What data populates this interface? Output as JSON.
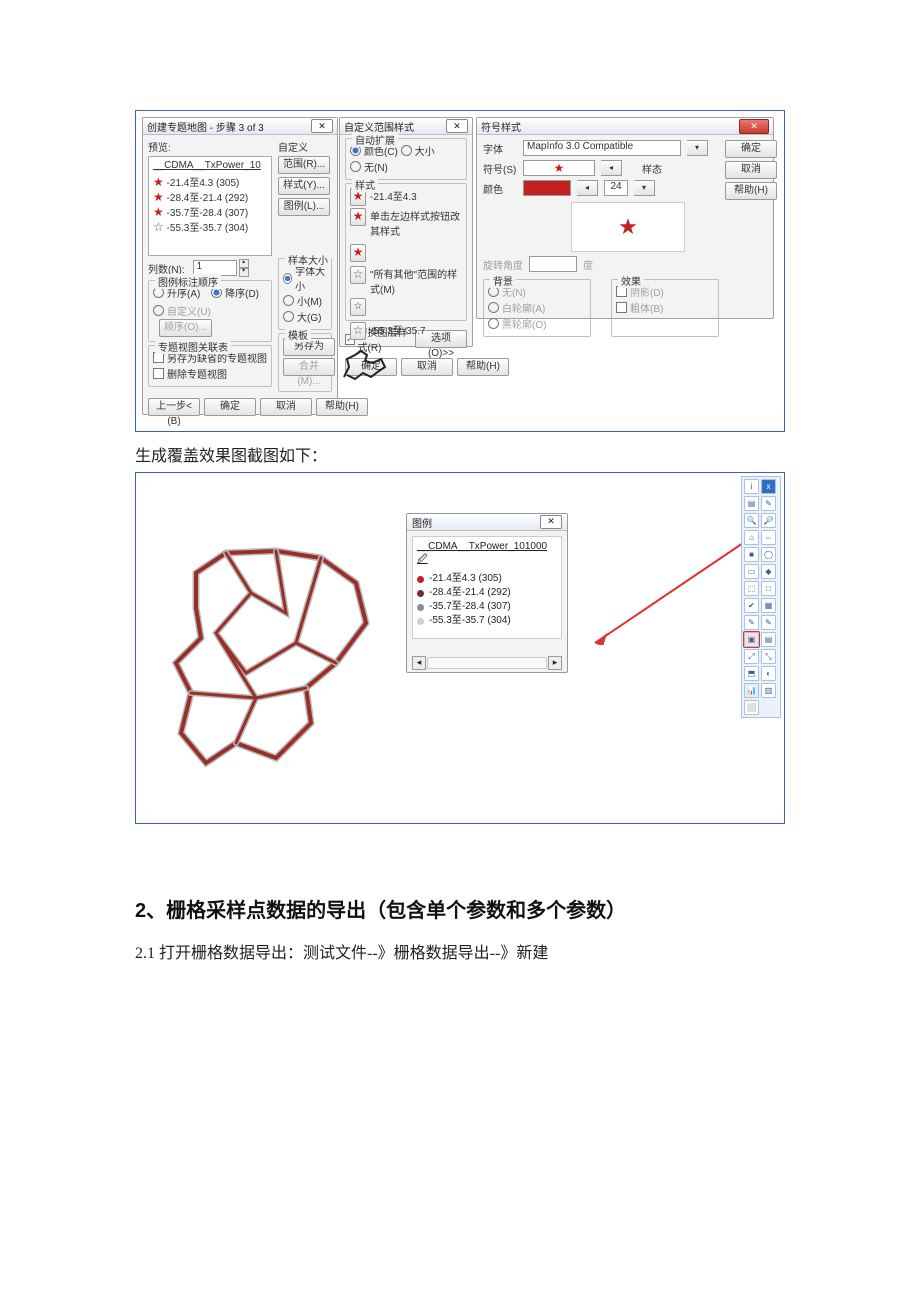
{
  "dialog1": {
    "title": "创建专题地图 - 步骤 3 of 3",
    "preview_label": "预览:",
    "custom_label": "自定义",
    "data_label": "__CDMA__TxPower_10",
    "ranges": [
      {
        "text": "-21.4至4.3  (305)"
      },
      {
        "text": "-28.4至-21.4  (292)"
      },
      {
        "text": "-35.7至-28.4  (307)"
      },
      {
        "text": "-55.3至-35.7  (304)"
      }
    ],
    "btn_range": "范围(R)...",
    "btn_style": "样式(Y)...",
    "btn_legend": "图例(L)...",
    "col_label": "列数(N):",
    "col_value": "1",
    "order_group": "图例标注顺序",
    "order_asc": "升序(A)",
    "order_desc": "降序(D)",
    "order_custom": "自定义(U)",
    "order_btn": "顺序(O)...",
    "size_group": "样本大小",
    "size_font": "字体大小",
    "size_small": "小(M)",
    "size_large": "大(G)",
    "assoc_group": "专题视图关联表",
    "assoc_save": "另存为缺省的专题视图",
    "assoc_del": "删除专题视图",
    "tpl_group": "模板",
    "tpl_saveas": "另存为",
    "tpl_merge": "合并(M)...",
    "btn_back": "上一步< (B)",
    "btn_ok": "确定",
    "btn_cancel": "取消",
    "btn_help": "帮助(H)"
  },
  "dialog2": {
    "title": "自定义范围样式",
    "autoexp": "自动扩展",
    "ae_color": "颜色(C)",
    "ae_size": "大小",
    "ae_none": "无(N)",
    "style_group": "样式",
    "r1": "-21.4至4.3",
    "hint": "单击左边样式按钮改其样式",
    "others": "\"所有其他\"范围的样式(M)",
    "last_range": "-55.3至-35.7",
    "replace": "替换图层样式(R)",
    "opts": "选项(O)>>",
    "ok": "确定",
    "cancel": "取消",
    "help": "帮助(H)"
  },
  "dialog3": {
    "title": "符号样式",
    "font_label": "字体",
    "font_value": "MapInfo 3.0 Compatible",
    "sym_label": "符号(S)",
    "sample_label": "样态",
    "color_label": "颜色",
    "size": "24",
    "rotate_label": "旋转角度",
    "rotate_ph": "度",
    "bg_group": "背景",
    "bg_none": "无(N)",
    "bg_white": "白轮廓(A)",
    "bg_black": "黑轮廓(O)",
    "fx_group": "效果",
    "fx_shadow": "阴影(D)",
    "fx_bold": "粗体(B)",
    "ok": "确定",
    "cancel": "取消",
    "help": "帮助(H)"
  },
  "para_text": "生成覆盖效果图截图如下：",
  "legend2": {
    "title": "图例",
    "hdr": "__CDMA__TxPower_101000 🖉",
    "rows": [
      {
        "color": "#c02020",
        "text": "-21.4至4.3  (305)"
      },
      {
        "color": "#7a2a2a",
        "text": "-28.4至-21.4  (292)"
      },
      {
        "color": "#8a8a8a",
        "text": "-35.7至-28.4  (307)"
      },
      {
        "color": "#cfcfcf",
        "text": "-55.3至-35.7  (304)"
      }
    ]
  },
  "section2_title": "2、栅格采样点数据的导出（包含单个参数和多个参数）",
  "section2_line": "2.1   打开栅格数据导出：测试文件--》栅格数据导出--》新建"
}
